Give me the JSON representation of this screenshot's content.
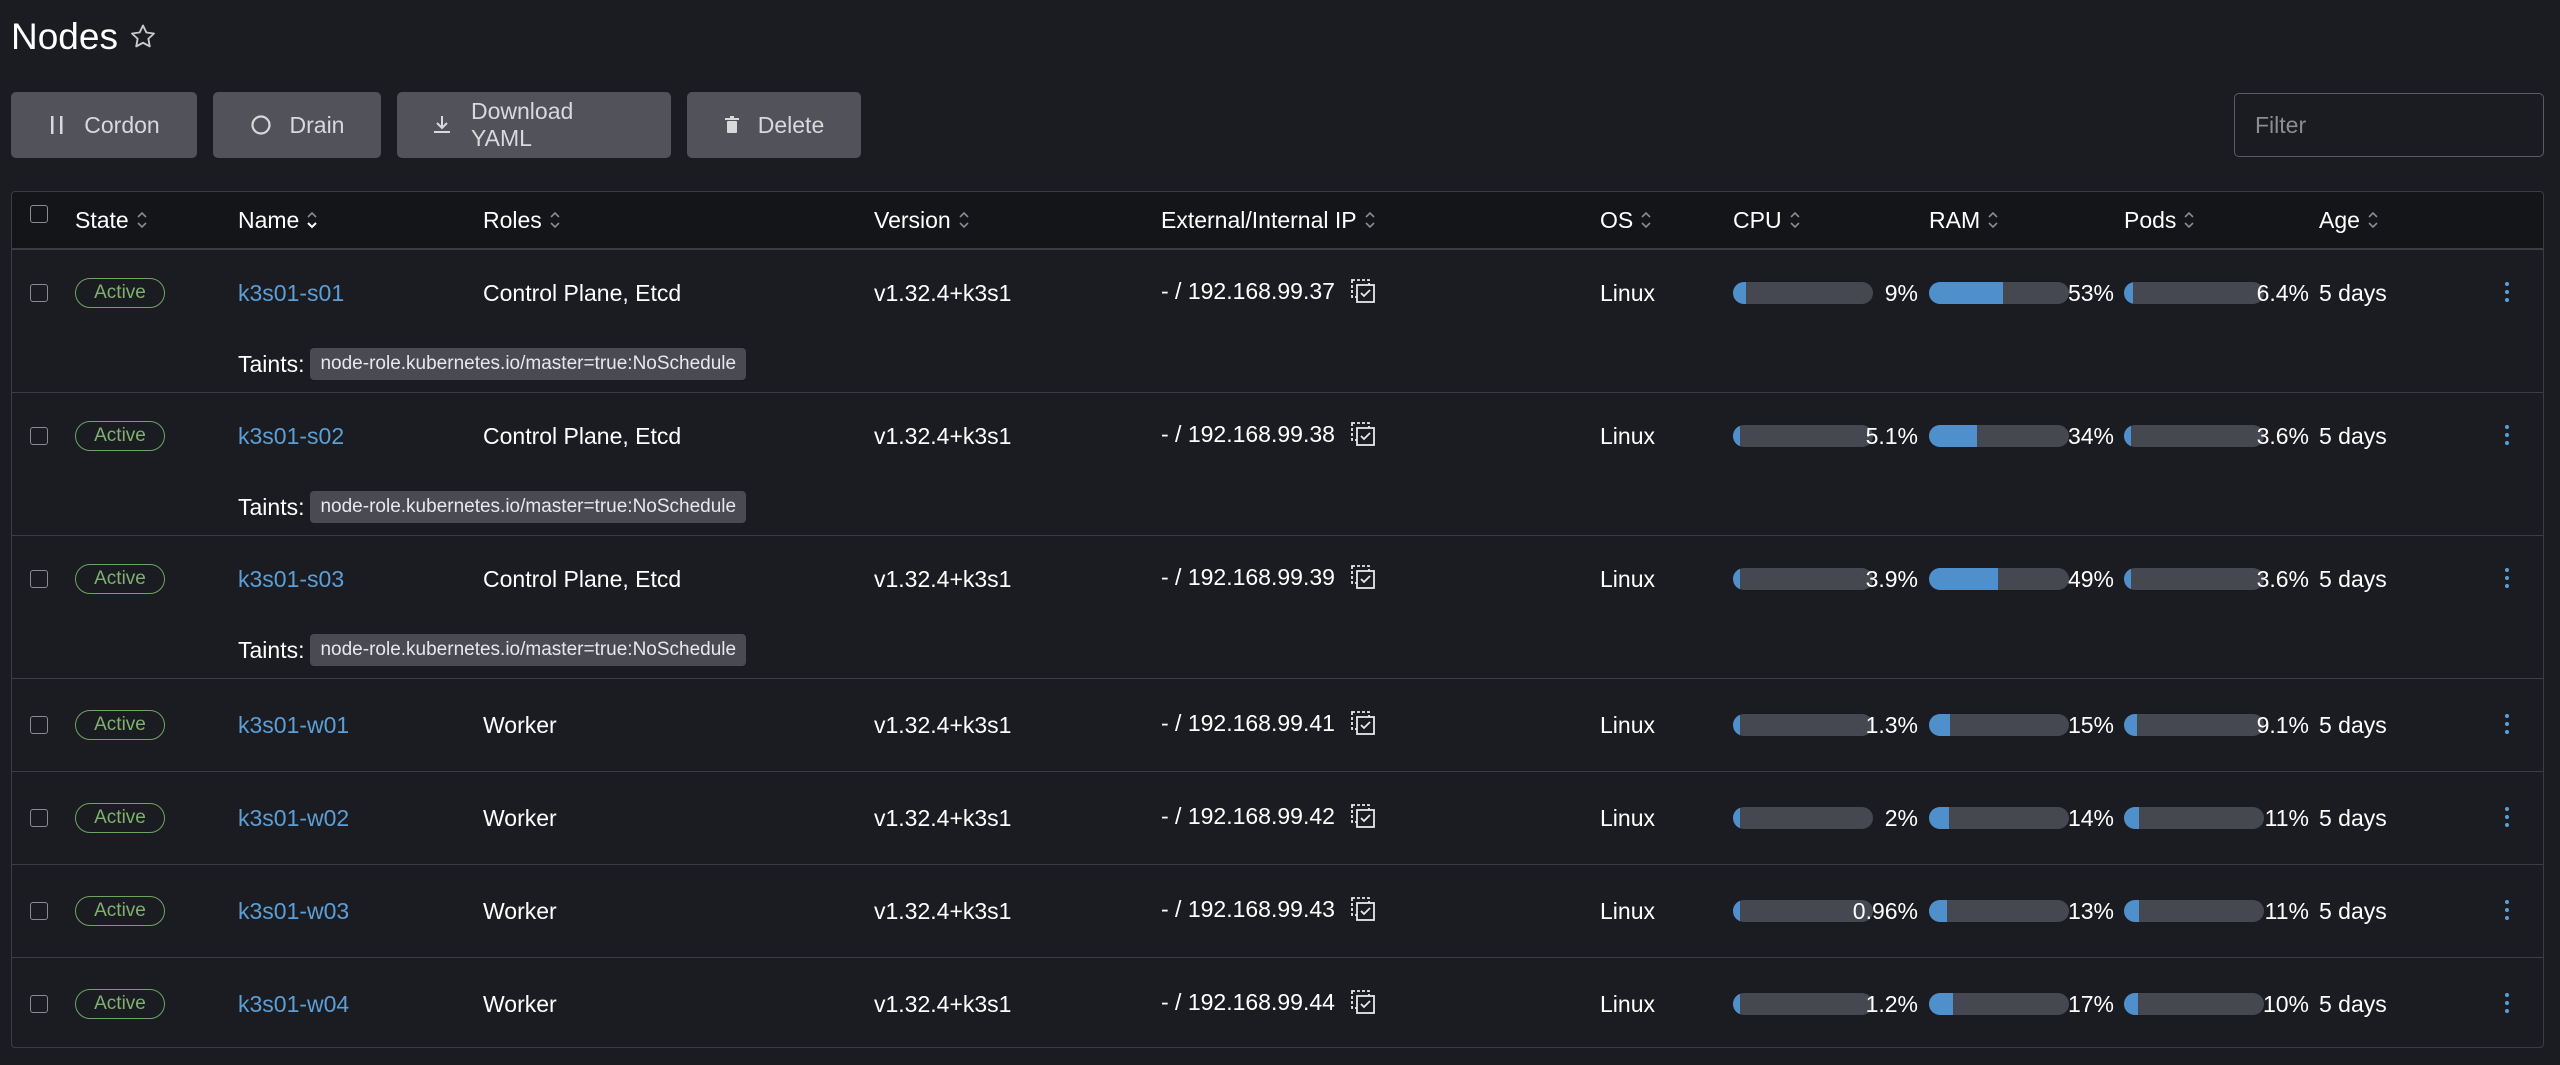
{
  "page": {
    "title": "Nodes"
  },
  "toolbar": {
    "cordon_label": "Cordon",
    "drain_label": "Drain",
    "download_label": "Download YAML",
    "delete_label": "Delete",
    "filter_placeholder": "Filter"
  },
  "columns": {
    "state": "State",
    "name": "Name",
    "roles": "Roles",
    "version": "Version",
    "ip": "External/Internal IP",
    "os": "OS",
    "cpu": "CPU",
    "ram": "RAM",
    "pods": "Pods",
    "age": "Age"
  },
  "taints_label": "Taints:",
  "colors": {
    "accent": "#5b9fd6",
    "active": "#7fb070",
    "bar_fill": "#4e8fcc",
    "bar_track": "#454850"
  },
  "rows": [
    {
      "state": "Active",
      "name": "k3s01-s01",
      "roles": "Control Plane, Etcd",
      "version": "v1.32.4+k3s1",
      "ip": "- / 192.168.99.37",
      "os": "Linux",
      "cpu": "9%",
      "cpu_frac": 0.09,
      "ram": "53%",
      "ram_frac": 0.53,
      "pods": "6.4%",
      "pods_frac": 0.064,
      "age": "5 days",
      "taint": "node-role.kubernetes.io/master=true:NoSchedule"
    },
    {
      "state": "Active",
      "name": "k3s01-s02",
      "roles": "Control Plane, Etcd",
      "version": "v1.32.4+k3s1",
      "ip": "- / 192.168.99.38",
      "os": "Linux",
      "cpu": "5.1%",
      "cpu_frac": 0.051,
      "ram": "34%",
      "ram_frac": 0.34,
      "pods": "3.6%",
      "pods_frac": 0.036,
      "age": "5 days",
      "taint": "node-role.kubernetes.io/master=true:NoSchedule"
    },
    {
      "state": "Active",
      "name": "k3s01-s03",
      "roles": "Control Plane, Etcd",
      "version": "v1.32.4+k3s1",
      "ip": "- / 192.168.99.39",
      "os": "Linux",
      "cpu": "3.9%",
      "cpu_frac": 0.039,
      "ram": "49%",
      "ram_frac": 0.49,
      "pods": "3.6%",
      "pods_frac": 0.036,
      "age": "5 days",
      "taint": "node-role.kubernetes.io/master=true:NoSchedule"
    },
    {
      "state": "Active",
      "name": "k3s01-w01",
      "roles": "Worker",
      "version": "v1.32.4+k3s1",
      "ip": "- / 192.168.99.41",
      "os": "Linux",
      "cpu": "1.3%",
      "cpu_frac": 0.013,
      "ram": "15%",
      "ram_frac": 0.15,
      "pods": "9.1%",
      "pods_frac": 0.091,
      "age": "5 days"
    },
    {
      "state": "Active",
      "name": "k3s01-w02",
      "roles": "Worker",
      "version": "v1.32.4+k3s1",
      "ip": "- / 192.168.99.42",
      "os": "Linux",
      "cpu": "2%",
      "cpu_frac": 0.02,
      "ram": "14%",
      "ram_frac": 0.14,
      "pods": "11%",
      "pods_frac": 0.11,
      "age": "5 days"
    },
    {
      "state": "Active",
      "name": "k3s01-w03",
      "roles": "Worker",
      "version": "v1.32.4+k3s1",
      "ip": "- / 192.168.99.43",
      "os": "Linux",
      "cpu": "0.96%",
      "cpu_frac": 0.0096,
      "ram": "13%",
      "ram_frac": 0.13,
      "pods": "11%",
      "pods_frac": 0.11,
      "age": "5 days"
    },
    {
      "state": "Active",
      "name": "k3s01-w04",
      "roles": "Worker",
      "version": "v1.32.4+k3s1",
      "ip": "- / 192.168.99.44",
      "os": "Linux",
      "cpu": "1.2%",
      "cpu_frac": 0.012,
      "ram": "17%",
      "ram_frac": 0.17,
      "pods": "10%",
      "pods_frac": 0.1,
      "age": "5 days"
    }
  ]
}
